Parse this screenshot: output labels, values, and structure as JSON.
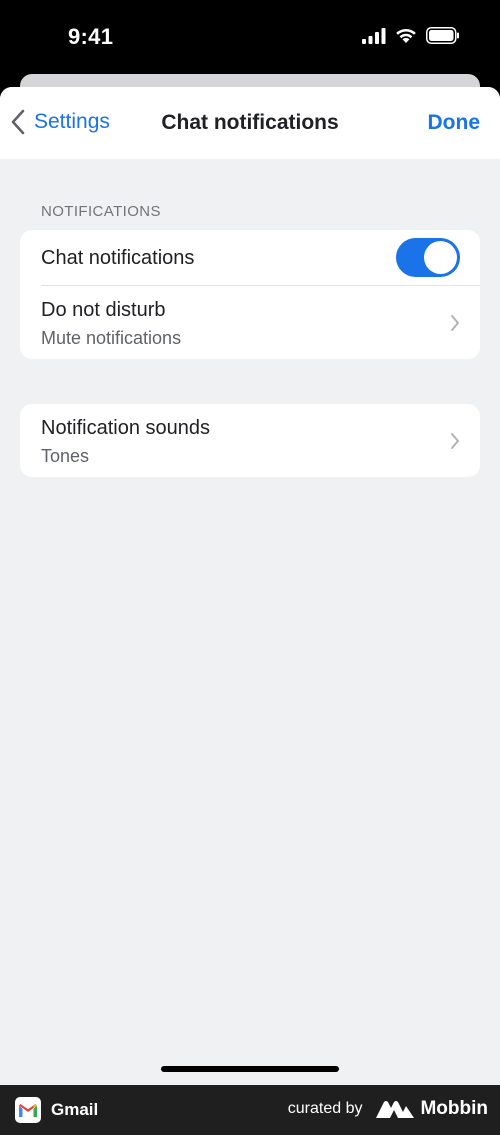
{
  "status_bar": {
    "time": "9:41"
  },
  "nav": {
    "back_label": "Settings",
    "title": "Chat notifications",
    "done_label": "Done"
  },
  "section": {
    "header": "NOTIFICATIONS"
  },
  "rows": {
    "chat": {
      "title": "Chat notifications",
      "toggle_on": true
    },
    "dnd": {
      "title": "Do not disturb",
      "subtitle": "Mute notifications"
    },
    "sounds": {
      "title": "Notification sounds",
      "subtitle": "Tones"
    }
  },
  "footer": {
    "app_name": "Gmail",
    "curated_by": "curated by",
    "brand": "Mobbin"
  },
  "colors": {
    "accent": "#1a73e8",
    "background": "#f0f1f3"
  }
}
